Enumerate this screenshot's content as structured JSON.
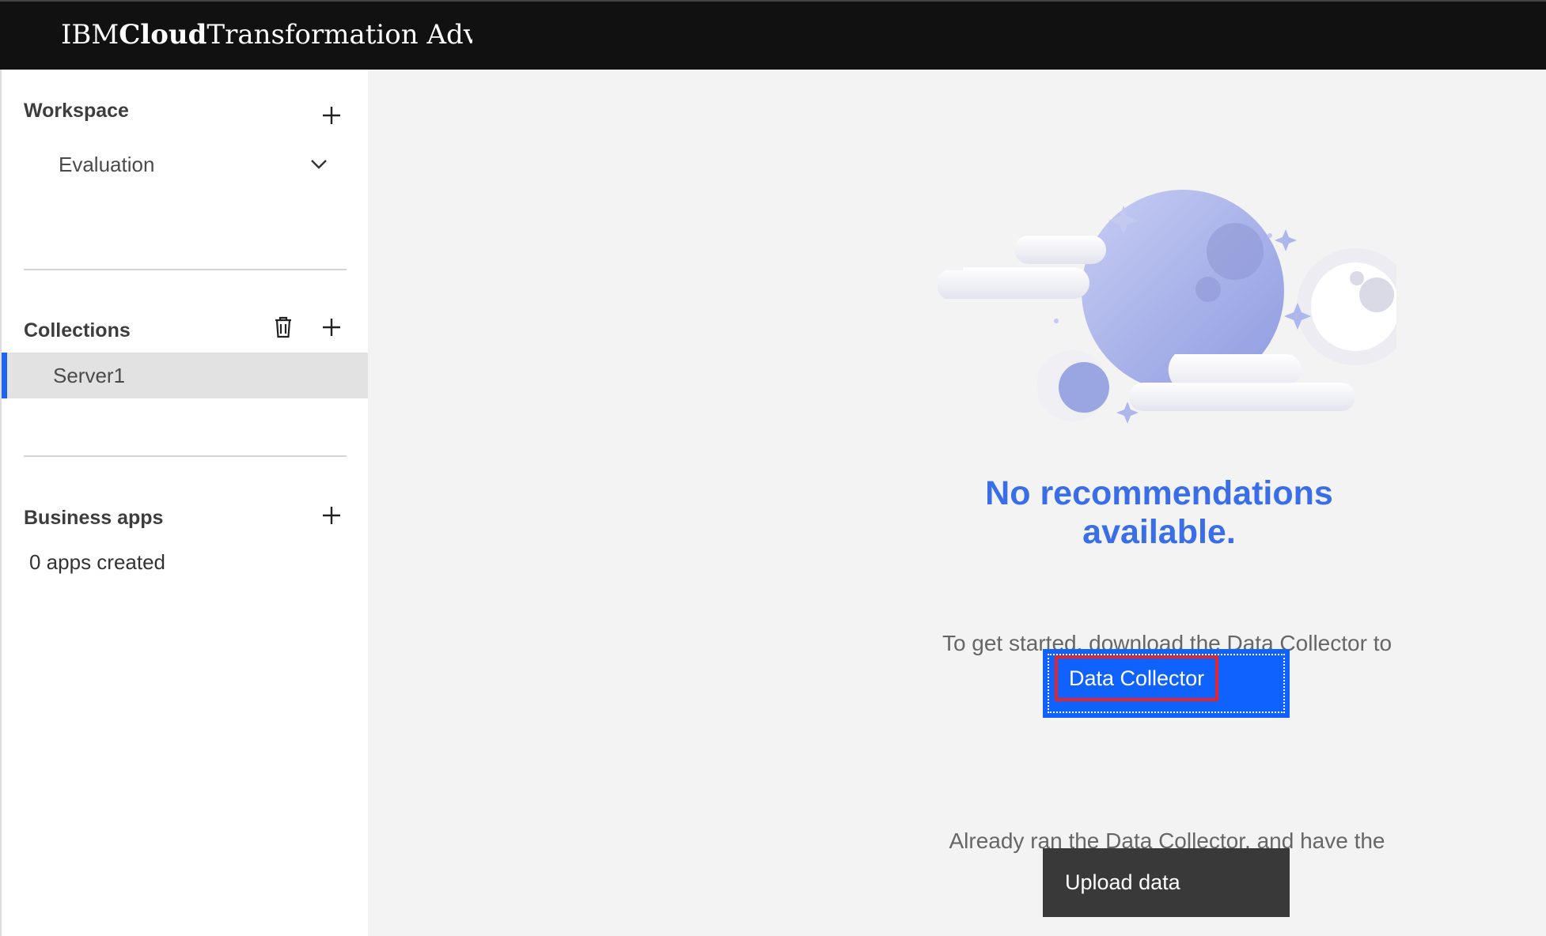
{
  "header": {
    "brand_ibm": "IBM",
    "brand_cloud": "Cloud",
    "brand_product": "Transformation Advis"
  },
  "sidebar": {
    "workspace": {
      "title": "Workspace",
      "selected": "Evaluation"
    },
    "collections": {
      "title": "Collections",
      "items": [
        {
          "label": "Server1",
          "selected": true
        }
      ]
    },
    "business_apps": {
      "title": "Business apps",
      "count_text": "0 apps created"
    }
  },
  "main": {
    "title": "No recommendations available.",
    "description": "To get started, download the Data Collector to retrieve application data.",
    "primary_button": "Data Collector",
    "secondary_description": "Already ran the Data Collector, and have the results to upload?",
    "secondary_button": "Upload data"
  },
  "colors": {
    "header_bg": "#111111",
    "primary": "#0f62fe",
    "title": "#3a6ee8",
    "secondary_button": "#393939",
    "selected_indicator": "#1f63ee"
  },
  "icons": [
    "add-icon",
    "chevron-down-icon",
    "trash-icon"
  ]
}
